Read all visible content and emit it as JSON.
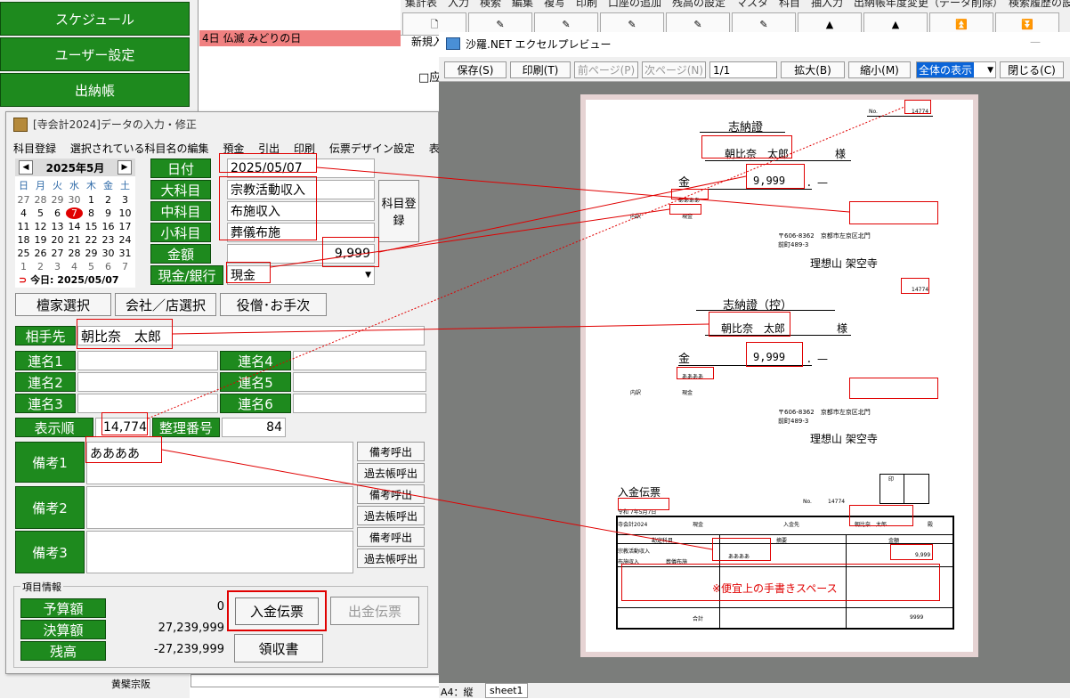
{
  "left_menu": {
    "schedule": "スケジュール",
    "user_settings": "ユーザー設定",
    "cashbook": "出納帳"
  },
  "calendar_strip": {
    "holiday": "4日 仏滅 みどりの日"
  },
  "background_app": {
    "menu_text": "集計表　入力　検索　編集　複写　印刷　口座の追加　残高の設定　マスタ　科目　抽入力　出納帳年度変更（データ削除）　検索履歴の設",
    "new_button": "新規入",
    "check_label": "□应"
  },
  "input_window": {
    "title": "[寺会計2024]データの入力・修正",
    "menu": [
      "科目登録",
      "選択されている科目名の編集",
      "預金",
      "引出",
      "印刷",
      "伝票デザイン設定",
      "表示設定"
    ],
    "calendar": {
      "month": "2025年5月",
      "weekdays": [
        "日",
        "月",
        "火",
        "水",
        "木",
        "金",
        "土"
      ],
      "days": [
        [
          "27",
          "28",
          "29",
          "30",
          "1",
          "2",
          "3"
        ],
        [
          "4",
          "5",
          "6",
          "7",
          "8",
          "9",
          "10"
        ],
        [
          "11",
          "12",
          "13",
          "14",
          "15",
          "16",
          "17"
        ],
        [
          "18",
          "19",
          "20",
          "21",
          "22",
          "23",
          "24"
        ],
        [
          "25",
          "26",
          "27",
          "28",
          "29",
          "30",
          "31"
        ],
        [
          "1",
          "2",
          "3",
          "4",
          "5",
          "6",
          "7"
        ]
      ],
      "today": "今日: 2025/05/07"
    },
    "fields": {
      "date_label": "日付",
      "date_value": "2025/05/07",
      "major_label": "大科目",
      "major_value": "宗教活動収入",
      "middle_label": "中科目",
      "middle_value": "布施収入",
      "minor_label": "小科目",
      "minor_value": "葬儀布施",
      "amount_label": "金額",
      "amount_value": "9,999",
      "cash_label": "現金/銀行",
      "cash_value": "現金"
    },
    "register_button": "科目登録",
    "select_buttons": [
      "檀家選択",
      "会社／店選択",
      "役僧･お手次"
    ],
    "party_label": "相手先",
    "party_value": "朝比奈　太郎",
    "joint_labels": [
      "連名1",
      "連名2",
      "連名3",
      "連名4",
      "連名5",
      "連名6"
    ],
    "order_label": "表示順",
    "order_value": "14,774",
    "ref_label": "整理番号",
    "ref_value": "84",
    "notes": [
      {
        "label": "備考1",
        "value": "ああああ"
      },
      {
        "label": "備考2",
        "value": ""
      },
      {
        "label": "備考3",
        "value": ""
      }
    ],
    "note_call": "備考呼出",
    "past_call": "過去帳呼出",
    "item_info_title": "項目情報",
    "budget_label": "予算額",
    "budget_value": "0",
    "settled_label": "決算額",
    "settled_value": "27,239,999",
    "balance_label": "残高",
    "balance_value": "-27,239,999",
    "deposit_slip": "入金伝票",
    "withdraw_slip": "出金伝票",
    "receipt": "領収書",
    "sect": "黄檗宗阪"
  },
  "preview": {
    "title": "沙羅.NET エクセルプレビュー",
    "toolbar": {
      "save": "保存(S)",
      "print": "印刷(T)",
      "prev": "前ページ(P)",
      "next": "次ページ(N)",
      "page": "1/1",
      "zoom_in": "拡大(B)",
      "zoom_out": "縮小(M)",
      "view": "全体の表示",
      "close": "閉じる(C)"
    },
    "doc": {
      "title1": "志納證",
      "title2": "志納證（控）",
      "no_label": "No.",
      "no_value": "14774",
      "name": "朝比奈　太郎",
      "honorific": "様",
      "kin": "金",
      "amount": "9,999",
      "dash": "．—",
      "memo": "ああああ",
      "naiyou": "内訳",
      "cash": "現金",
      "date": "令和　7年5月7日",
      "address": "〒606-8362　京都市左京区北門前町489-3",
      "temple": "理想山 架空寺",
      "slip_title": "入金伝票",
      "slip_stamp": "印",
      "slip_date": "令和 7年5月7日",
      "slip_company": "寺会計2024",
      "slip_cash": "現金",
      "slip_payer_label": "入金先",
      "slip_name": "朝比奈　太郎",
      "slip_dono": "殿",
      "col_account": "勘定科目",
      "col_summary": "摘要",
      "col_amount": "金額",
      "row_account1": "宗教活動収入",
      "row_account2": "布施収入",
      "row_account3": "葬儀布施",
      "row_amount": "9,999",
      "handwrite": "※便宜上の手書きスペース",
      "total_label": "合計",
      "total_value": "9999"
    },
    "status_paper": "A4：縦",
    "status_sheet": "sheet1"
  }
}
